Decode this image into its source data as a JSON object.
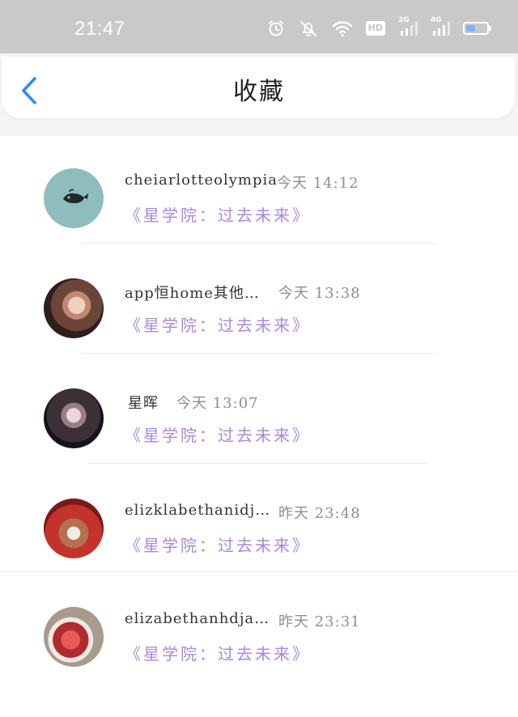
{
  "status_bar": {
    "time": "21:47",
    "icons": [
      "alarm-icon",
      "mute-icon",
      "wifi-icon",
      "hd-icon",
      "signal-2g-icon",
      "signal-4g-icon",
      "battery-icon"
    ],
    "hd_label": "HD",
    "net_2g_label": "2G",
    "net_4g_label": "4G",
    "battery_level": 0.45
  },
  "header": {
    "title": "收藏",
    "back_icon": "chevron-left-icon",
    "accent_color": "#2b8cf2"
  },
  "favorites": [
    {
      "user": "cheiarlotteolympia",
      "time": "今天 14:12",
      "book": "《星学院：过去未来》",
      "avatar": "whale-logo-avatar"
    },
    {
      "user": "app恒home其他…",
      "time": "今天 13:38",
      "book": "《星学院：过去未来》",
      "avatar": "woman-portrait-avatar"
    },
    {
      "user": "星晖",
      "time": "今天 13:07",
      "book": "《星学院：过去未来》",
      "avatar": "dark-portrait-avatar"
    },
    {
      "user": "elizklabethanidj…",
      "time": "昨天 23:48",
      "book": "《星学院：过去未来》",
      "avatar": "dog-hoodie-avatar"
    },
    {
      "user": "elizabethanhdja…",
      "time": "昨天 23:31",
      "book": "《星学院：过去未来》",
      "avatar": "red-sneakers-avatar"
    }
  ],
  "colors": {
    "status_bar_bg": "#c9c9c9",
    "book_link": "#a989d8",
    "time_text": "#8e8e8e",
    "username": "#333333"
  }
}
